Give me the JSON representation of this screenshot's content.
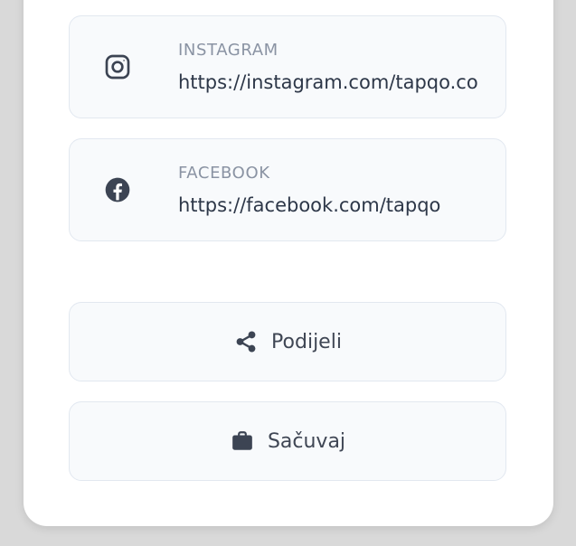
{
  "links": [
    {
      "label": "INSTAGRAM",
      "url": "https://instagram.com/tapqo.co",
      "icon": "instagram-icon"
    },
    {
      "label": "FACEBOOK",
      "url": "https://facebook.com/tapqo",
      "icon": "facebook-icon"
    }
  ],
  "actions": {
    "share_label": "Podijeli",
    "share_icon": "share-icon",
    "save_label": "Sačuvaj",
    "save_icon": "briefcase-icon"
  },
  "colors": {
    "icon": "#3c4453",
    "label": "#8a93a3",
    "text": "#2d3748",
    "item_bg": "#f8fafc",
    "item_border": "#e2e8f0"
  }
}
